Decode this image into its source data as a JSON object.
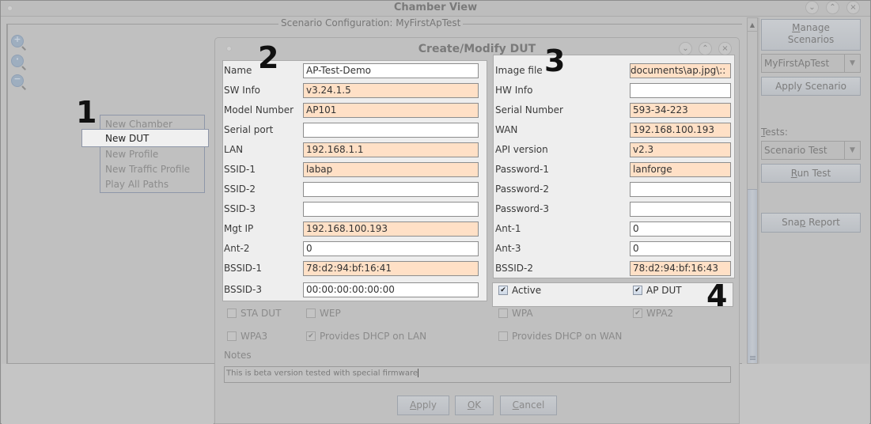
{
  "window": {
    "title": "Chamber View",
    "controls": {
      "minimize": "⌄",
      "maximize": "⌃",
      "close": "×"
    }
  },
  "scenario": {
    "legend": "Scenario Configuration:  MyFirstApTest"
  },
  "zoom_tools": [
    {
      "icon": "zoom-in-icon",
      "glyph": "+"
    },
    {
      "icon": "zoom-reset-icon",
      "glyph": "·"
    },
    {
      "icon": "zoom-out-icon",
      "glyph": "−"
    }
  ],
  "context_menu": {
    "items": [
      "New Chamber",
      "New DUT",
      "New Profile",
      "New Traffic Profile",
      "Play All Paths"
    ],
    "selected": "New DUT"
  },
  "annotations": [
    "1",
    "2",
    "3",
    "4"
  ],
  "right_panel": {
    "manage_scenarios": {
      "mnemonic": "M",
      "rest_line1": "anage",
      "line2": "Scenarios"
    },
    "scenario_select": "MyFirstApTest",
    "apply_scenario": "Apply Scenario",
    "tests_label": {
      "mnemonic": "T",
      "rest": "ests:"
    },
    "test_select": "Scenario Test",
    "run_test": {
      "mnemonic": "R",
      "rest": "un Test"
    },
    "snap_report": {
      "pre": "Sna",
      "mnemonic": "p",
      "rest": " Report"
    },
    "dropdown_arrow": "▼",
    "scroll_up_arrow": "▲"
  },
  "dialog": {
    "title": "Create/Modify DUT",
    "left_fields": [
      {
        "label": "Name",
        "value": "AP-Test-Demo",
        "required": false
      },
      {
        "label": "SW Info",
        "value": "v3.24.1.5",
        "required": true
      },
      {
        "label": "Model Number",
        "value": "AP101",
        "required": true
      },
      {
        "label": "Serial port",
        "value": "",
        "required": false
      },
      {
        "label": "LAN",
        "value": "192.168.1.1",
        "required": true
      },
      {
        "label": "SSID-1",
        "value": "labap",
        "required": true
      },
      {
        "label": "SSID-2",
        "value": "",
        "required": false
      },
      {
        "label": "SSID-3",
        "value": "",
        "required": false
      },
      {
        "label": "Mgt IP",
        "value": "192.168.100.193",
        "required": true
      },
      {
        "label": "Ant-2",
        "value": "0",
        "required": false
      },
      {
        "label": "BSSID-1",
        "value": "78:d2:94:bf:16:41",
        "required": true
      },
      {
        "label": "BSSID-3",
        "value": "00:00:00:00:00:00",
        "required": false
      }
    ],
    "right_fields": [
      {
        "label": "Image file",
        "value": "::\\documents\\ap.jpg",
        "required": true
      },
      {
        "label": "HW Info",
        "value": "",
        "required": false
      },
      {
        "label": "Serial Number",
        "value": "593-34-223",
        "required": true
      },
      {
        "label": "WAN",
        "value": "192.168.100.193",
        "required": true
      },
      {
        "label": "API version",
        "value": "v2.3",
        "required": true
      },
      {
        "label": "Password-1",
        "value": "lanforge",
        "required": true
      },
      {
        "label": "Password-2",
        "value": "",
        "required": false
      },
      {
        "label": "Password-3",
        "value": "",
        "required": false
      },
      {
        "label": "Ant-1",
        "value": "0",
        "required": false
      },
      {
        "label": "Ant-3",
        "value": "0",
        "required": false
      },
      {
        "label": "BSSID-2",
        "value": "78:d2:94:bf:16:43",
        "required": true
      }
    ],
    "highlighted_checks": [
      {
        "label": "Active",
        "checked": true
      },
      {
        "label": "AP DUT",
        "checked": true
      }
    ],
    "checks_row1": [
      {
        "label": "STA DUT",
        "checked": false
      },
      {
        "label": "WEP",
        "checked": false
      },
      {
        "label": "WPA",
        "checked": false
      },
      {
        "label": "WPA2",
        "checked": true
      }
    ],
    "checks_row2": [
      {
        "label": "WPA3",
        "checked": false
      },
      {
        "label": "Provides DHCP on LAN",
        "checked": true
      },
      {
        "label": "Provides DHCP on WAN",
        "checked": false
      }
    ],
    "notes_label": "Notes",
    "notes_value": "This is beta version tested with special firmware",
    "buttons": {
      "apply": {
        "mnemonic": "A",
        "rest": "pply"
      },
      "ok": {
        "pre": "",
        "mnemonic": "O",
        "rest": "K"
      },
      "cancel": {
        "mnemonic": "C",
        "rest": "ancel"
      }
    },
    "check_glyph": "✔"
  },
  "colors": {
    "required_field_bg": "#ffe0c6",
    "panel_bg": "#eeeeee",
    "dimmed_bg": "#c0c0c0"
  }
}
